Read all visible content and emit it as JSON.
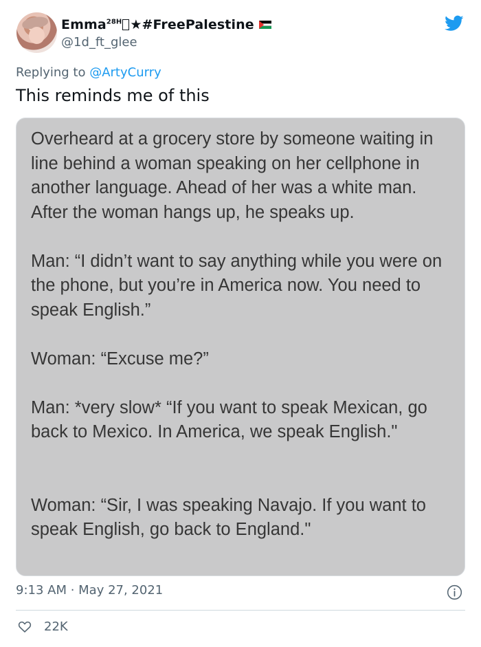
{
  "author": {
    "name_prefix": "Emma",
    "name_superscript": "28H",
    "name_suffix": "★#FreePalestine",
    "handle": "@1d_ft_glee",
    "avatar_name": "profile-avatar"
  },
  "reply": {
    "prefix": "Replying to ",
    "target": "@ArtyCurry"
  },
  "tweet": {
    "text": "This reminds me of this"
  },
  "quote": {
    "paragraphs": [
      "Overheard at a grocery store by someone waiting in line behind a woman speaking on her cellphone in another language. Ahead of her was a white man. After the woman hangs up, he speaks up.",
      "Man: “I didn’t want to say anything while you were on the phone, but you’re in America now. You need to speak English.”",
      "Woman: “Excuse me?”",
      "Man: *very slow* “If you want to speak Mexican, go back to Mexico. In America, we speak English.\"",
      "Woman: “Sir, I was speaking Navajo. If you want to speak English, go back to England.\""
    ]
  },
  "meta": {
    "timestamp": "9:13 AM · May 27, 2021",
    "likes": "22K"
  },
  "icons": {
    "twitter": "twitter-bird-icon",
    "info": "info-icon",
    "heart": "heart-icon",
    "flag": "palestine-flag-icon"
  },
  "colors": {
    "accent": "#1d9bf0",
    "secondary_text": "#536471",
    "primary_text": "#0f1419",
    "media_background": "#c9c9ca"
  }
}
